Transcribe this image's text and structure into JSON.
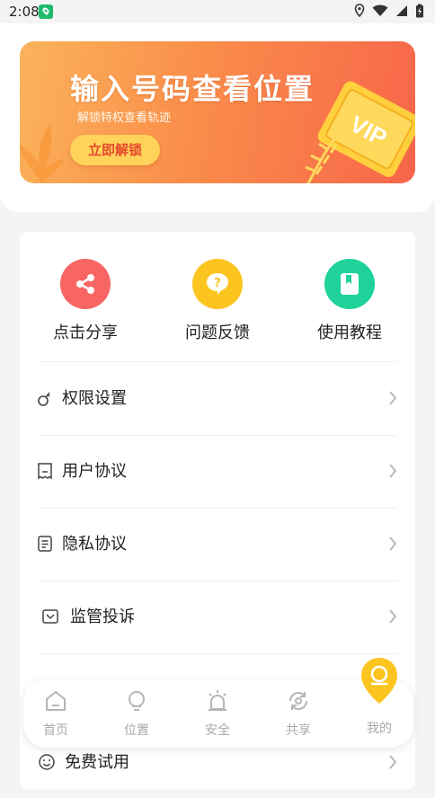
{
  "status_bar": {
    "time": "2:08"
  },
  "banner": {
    "title": "输入号码查看位置",
    "subtitle": "解锁特权查看轨迹",
    "button_label": "立即解锁",
    "badge_text": "VIP"
  },
  "quick_actions": [
    {
      "label": "点击分享",
      "icon": "share-icon",
      "color": "#f76662"
    },
    {
      "label": "问题反馈",
      "icon": "question-icon",
      "color": "#fcc41f"
    },
    {
      "label": "使用教程",
      "icon": "book-icon",
      "color": "#1ed29a"
    }
  ],
  "menu_items": [
    {
      "label": "权限设置",
      "icon": "key-icon"
    },
    {
      "label": "用户协议",
      "icon": "receipt-icon"
    },
    {
      "label": "隐私协议",
      "icon": "document-icon"
    },
    {
      "label": "监管投诉",
      "icon": "inbox-icon"
    },
    {
      "label": "免费试用",
      "icon": "smile-icon"
    }
  ],
  "tabbar": {
    "tabs": [
      {
        "label": "首页",
        "icon": "home-icon"
      },
      {
        "label": "位置",
        "icon": "location-pin-icon"
      },
      {
        "label": "安全",
        "icon": "alarm-icon"
      },
      {
        "label": "共享",
        "icon": "share-sync-icon"
      },
      {
        "label": "我的",
        "icon": "profile-icon"
      }
    ]
  },
  "colors": {
    "accent_yellow": "#fcc41f",
    "share_red": "#f76662",
    "book_green": "#1ed29a",
    "banner_orange": "#fa8d4a",
    "tab_label": "#a9a9a9"
  }
}
